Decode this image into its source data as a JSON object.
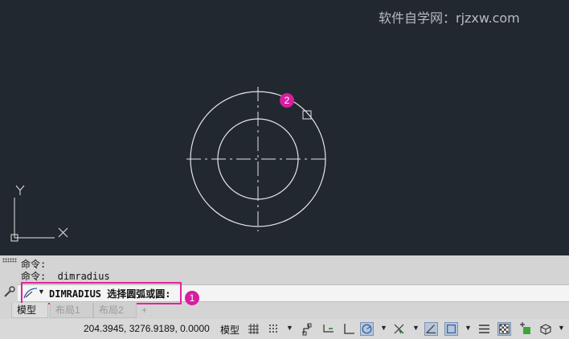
{
  "watermark": "软件自学网：rjzxw.com",
  "canvas": {
    "axis_y_label": "Y",
    "badge_2": "2"
  },
  "command_line": {
    "history": [
      "命令:",
      "命令:  dimradius"
    ],
    "current": "DIMRADIUS 选择圆弧或圆:",
    "badge_1": "1"
  },
  "layout_tabs": {
    "model": "模型",
    "layout1": "布局1",
    "layout2": "布局2",
    "add": "+"
  },
  "statusbar": {
    "coordinates": "204.3945, 3276.9189, 0.0000",
    "model_button": "模型",
    "icons": [
      "grid-icon",
      "snap-icon",
      "ortho-icon",
      "infer-icon",
      "polar-icon",
      "osnap-icon",
      "otrack-icon",
      "dynamic-ucs-icon",
      "selection-cycle-icon",
      "lineweight-icon",
      "transparency-icon",
      "annotation-icon",
      "workspace-icon"
    ]
  },
  "colors": {
    "canvas_bg": "#212830",
    "highlight": "#e0249c",
    "badge": "#d61ea0"
  }
}
